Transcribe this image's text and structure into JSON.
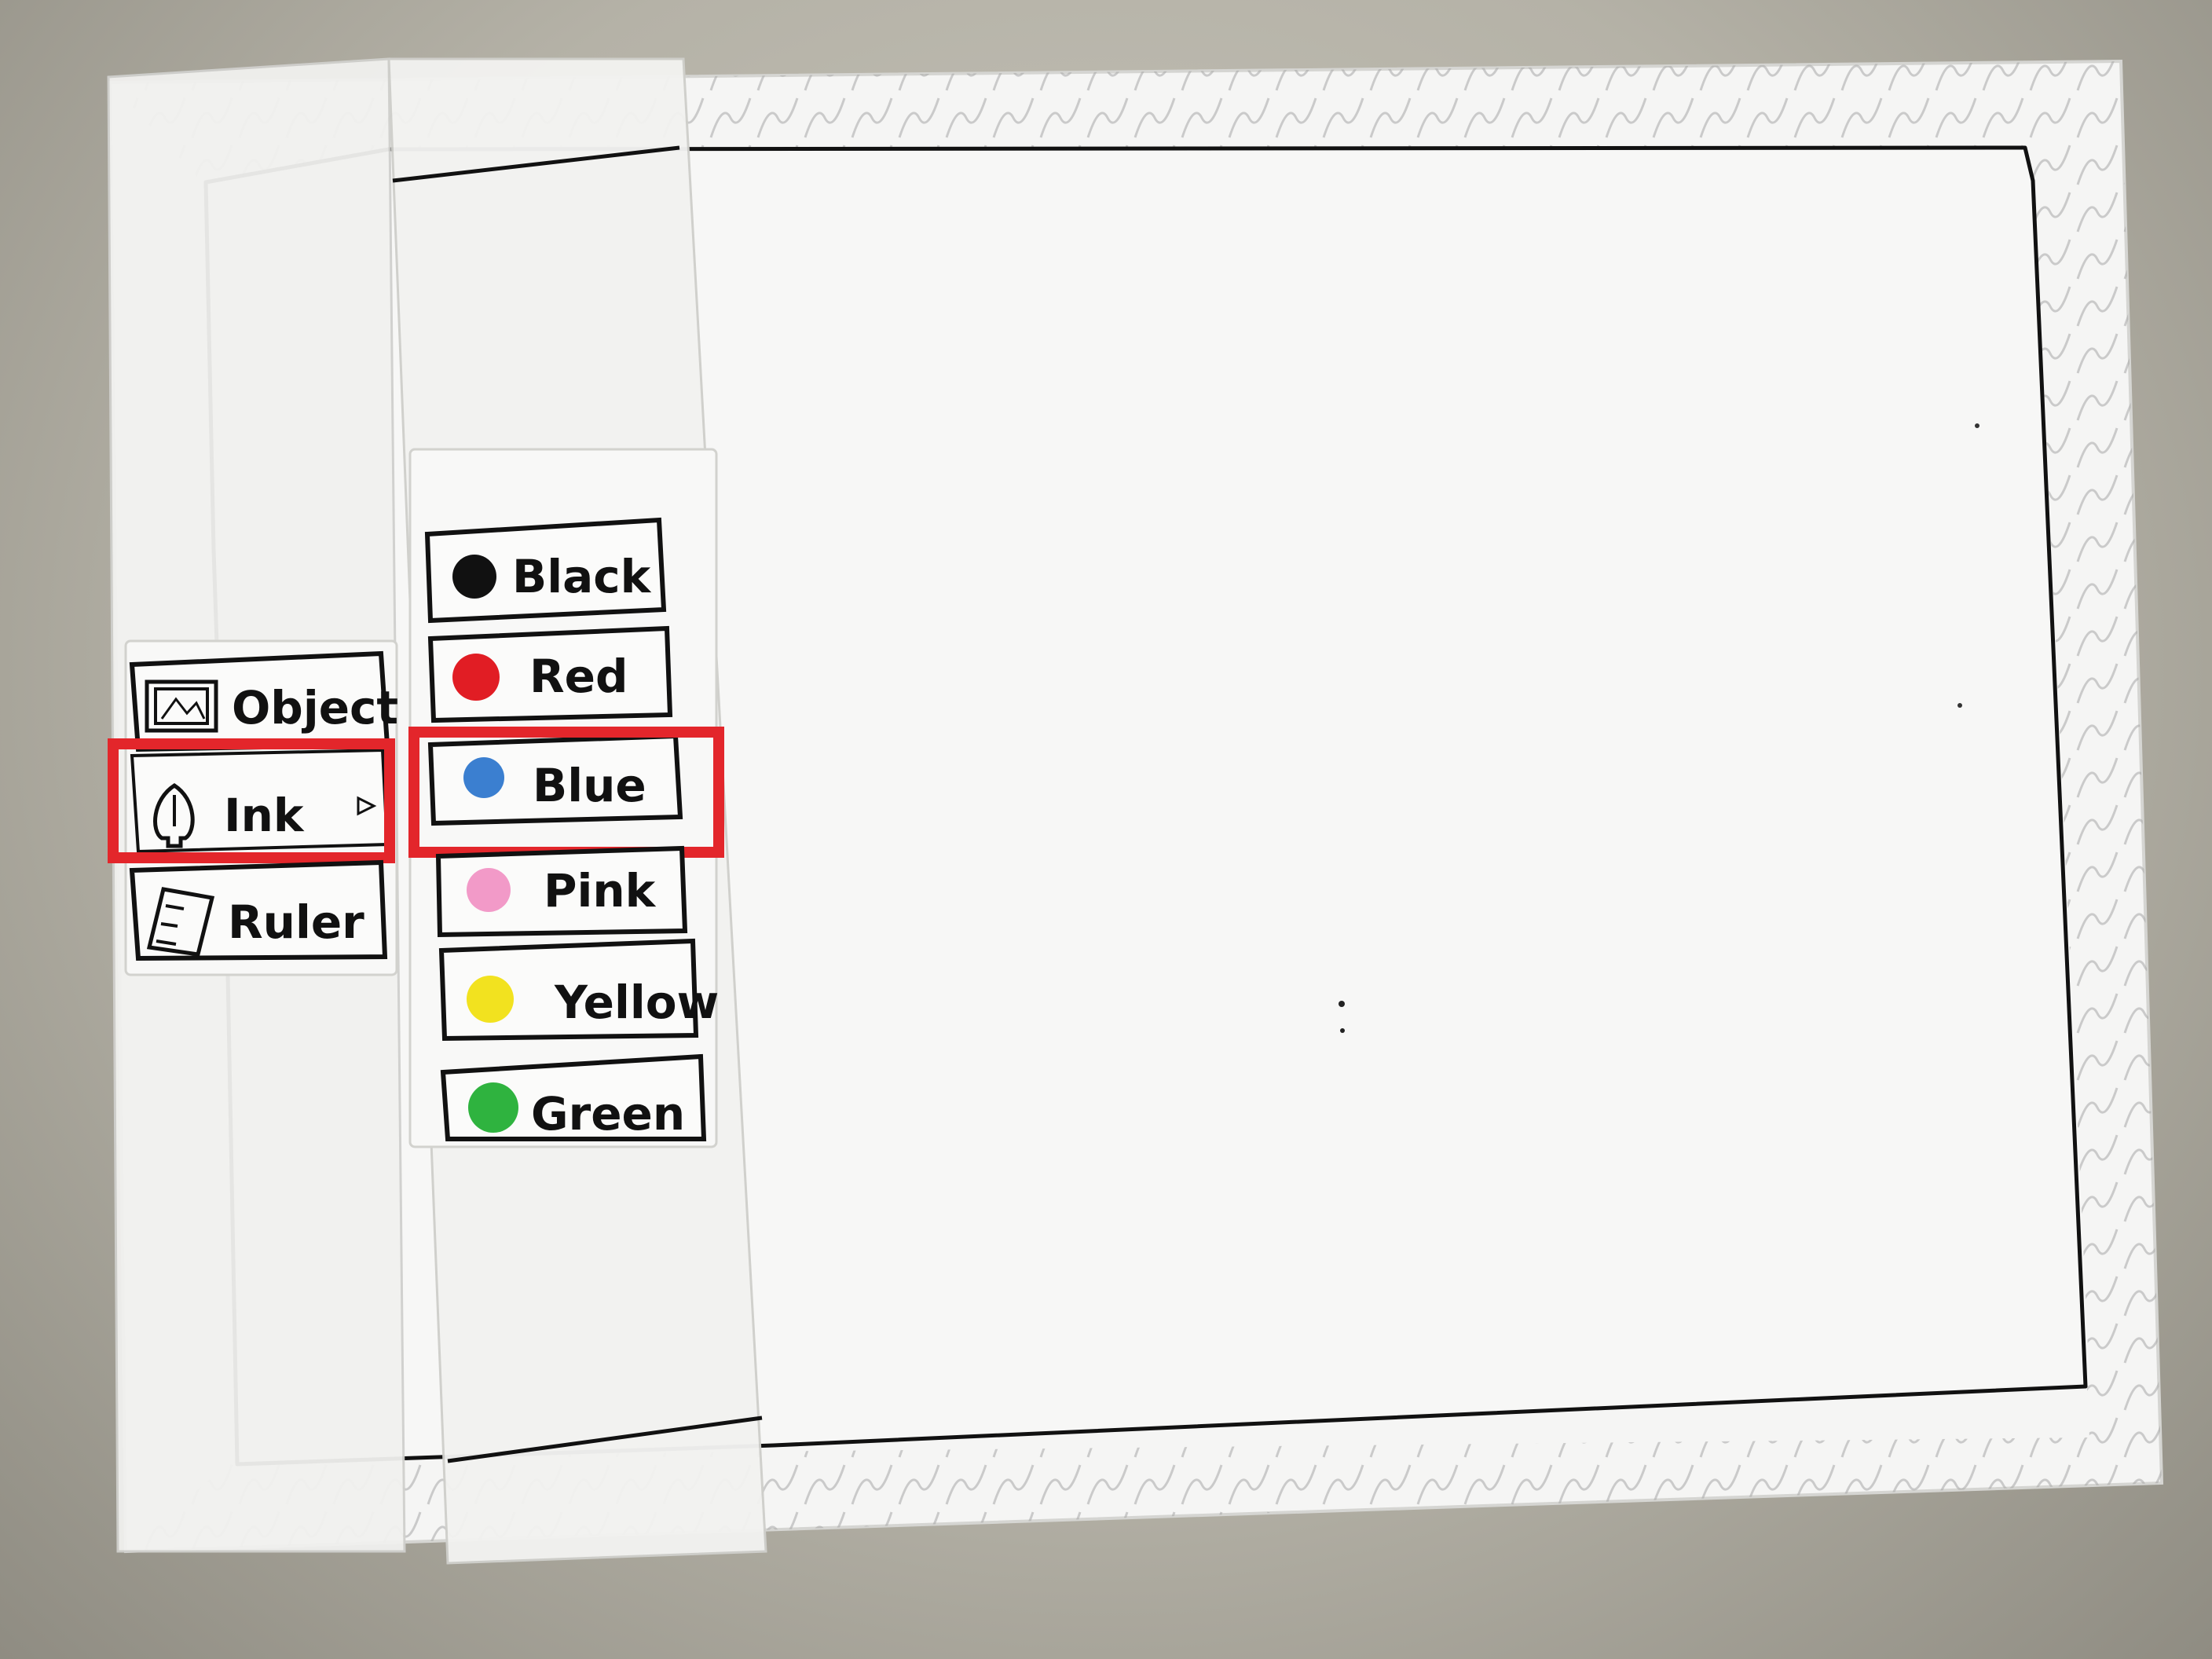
{
  "tool_menu": {
    "items": [
      {
        "label": "Object",
        "icon": "picture-frame-icon",
        "selected": false
      },
      {
        "label": "Ink",
        "icon": "pen-nib-icon",
        "selected": true
      },
      {
        "label": "Ruler",
        "icon": "ruler-icon",
        "selected": false
      }
    ]
  },
  "color_menu": {
    "items": [
      {
        "label": "Black",
        "color": "#111111",
        "selected": false
      },
      {
        "label": "Red",
        "color": "#e11d24",
        "selected": false
      },
      {
        "label": "Blue",
        "color": "#3b7fd0",
        "selected": true
      },
      {
        "label": "Pink",
        "color": "#f29ac8",
        "selected": false
      },
      {
        "label": "Yellow",
        "color": "#f2e21f",
        "selected": false
      },
      {
        "label": "Green",
        "color": "#2fb33f",
        "selected": false
      }
    ]
  },
  "highlight_color": "#e3262b"
}
